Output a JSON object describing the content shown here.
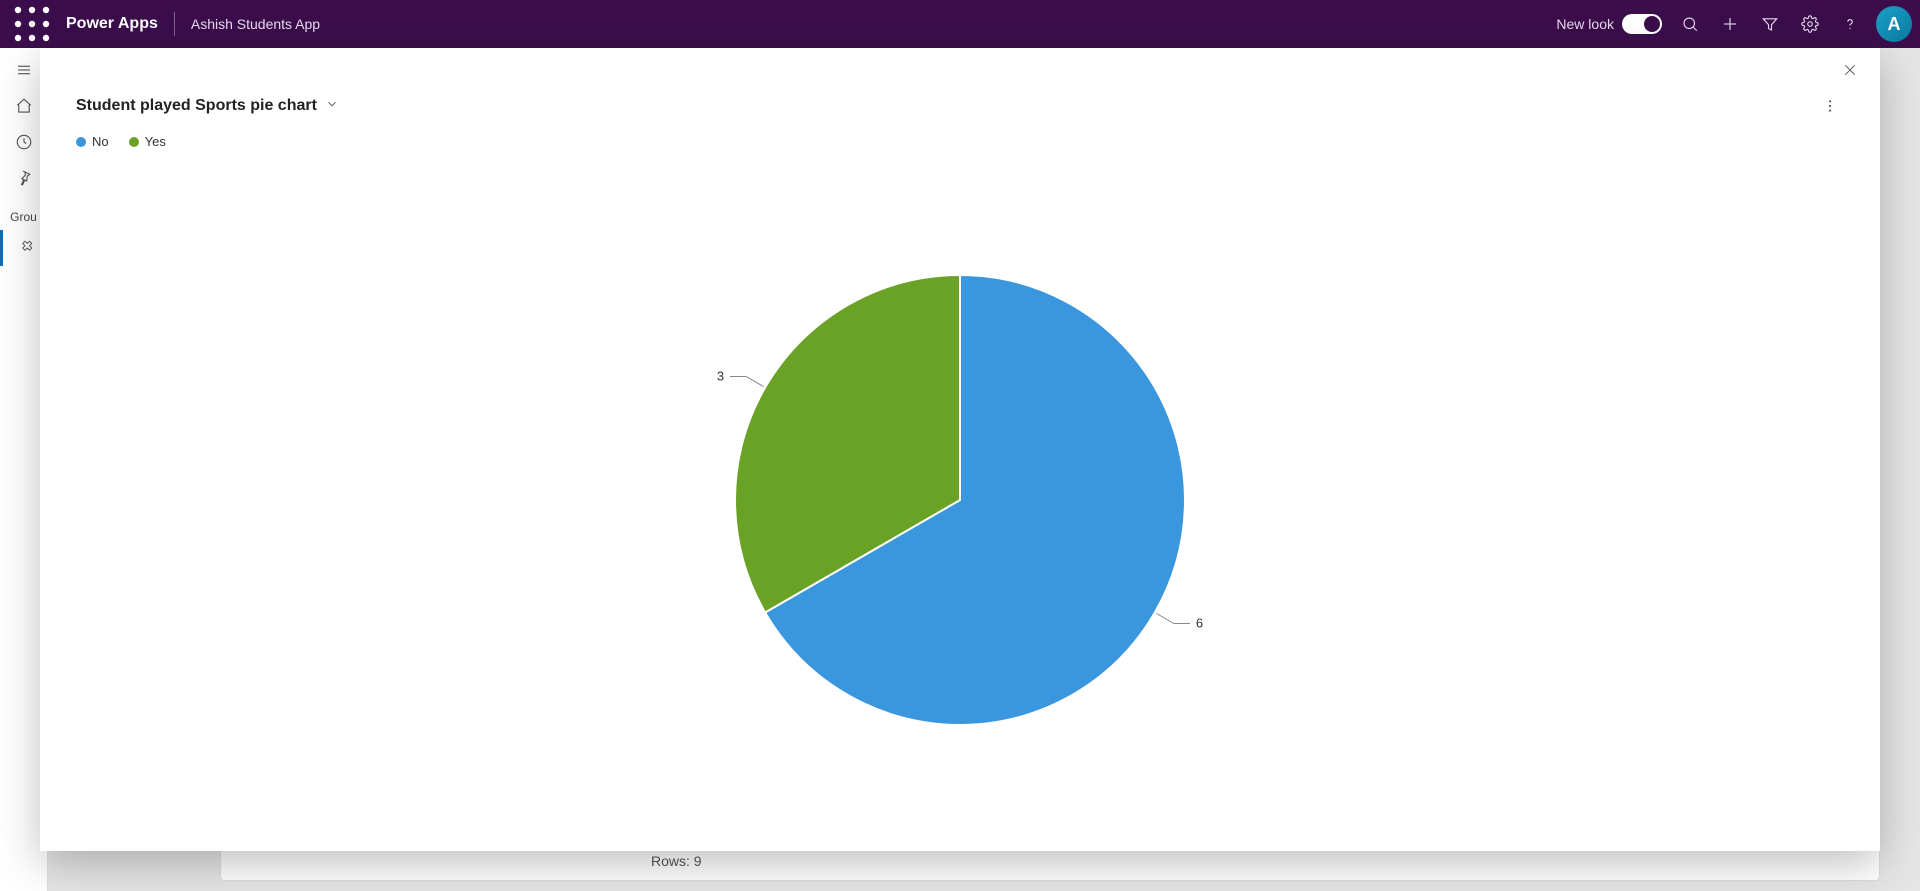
{
  "header": {
    "product": "Power Apps",
    "app_name": "Ashish Students App",
    "new_look_label": "New look",
    "avatar_initial": "A"
  },
  "rail": {
    "group_label": "Grou"
  },
  "background": {
    "rows_label": "Rows: 9"
  },
  "modal": {
    "title": "Student played Sports pie chart"
  },
  "colors": {
    "no": "#3a96dd",
    "yes": "#6aa225",
    "header_bg": "#3b0e4b"
  },
  "chart_data": {
    "type": "pie",
    "title": "Student played Sports pie chart",
    "series": [
      {
        "name": "No",
        "value": 6,
        "color": "#3a96dd"
      },
      {
        "name": "Yes",
        "value": 3,
        "color": "#6aa225"
      }
    ],
    "legend_position": "top-left",
    "data_labels": true
  }
}
